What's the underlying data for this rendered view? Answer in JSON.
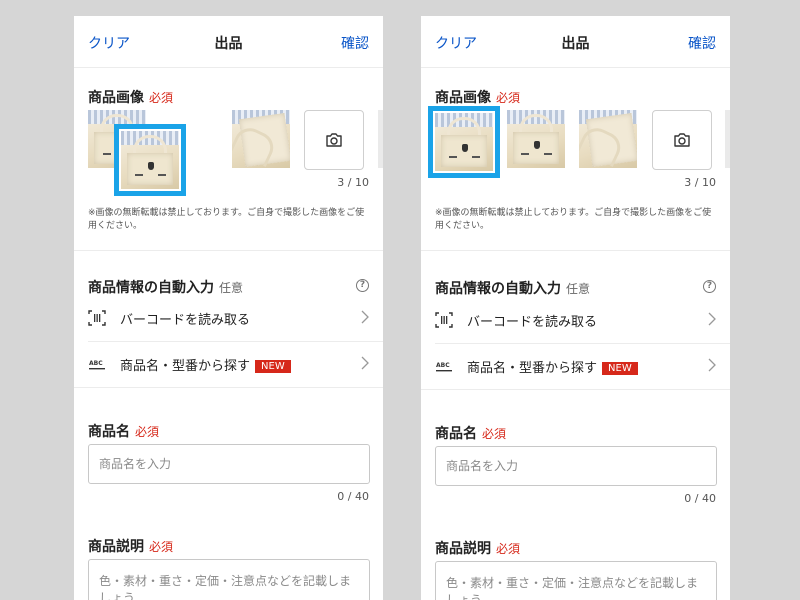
{
  "header": {
    "left": "クリア",
    "title": "出品",
    "right": "確認"
  },
  "photos": {
    "title": "商品画像",
    "required": "必須",
    "counter": "3 / 10",
    "note": "※画像の無断転載は禁止しております。ご自身で撮影した画像をご使用ください。",
    "camera_icon": "camera-icon"
  },
  "auto_input": {
    "title": "商品情報の自動入力",
    "optional": "任意",
    "help": "?",
    "barcode_label": "バーコードを読み取る",
    "search_label": "商品名・型番から探す",
    "badge": "NEW",
    "abc": "ABC"
  },
  "name_field": {
    "title": "商品名",
    "required": "必須",
    "placeholder": "商品名を入力",
    "counter": "0 / 40"
  },
  "desc_field": {
    "title": "商品説明",
    "required": "必須",
    "placeholder": "色・素材・重さ・定価・注意点などを記載しましょう"
  },
  "colors": {
    "link": "#0a55c8",
    "required": "#d6281a",
    "selection": "#1aa3e8"
  }
}
